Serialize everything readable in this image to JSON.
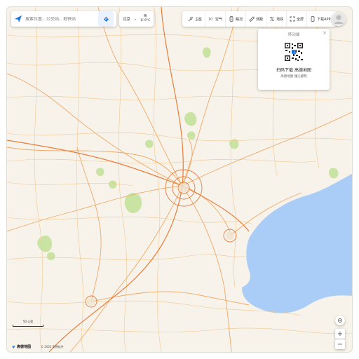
{
  "search": {
    "placeholder": "搜索位置、公交站、地铁站"
  },
  "weather": {
    "city": "北京",
    "condition": "晴",
    "temperature": "1/-9°C"
  },
  "toolbar": {
    "items": [
      {
        "label": "卫星",
        "icon": "satellite-icon"
      },
      {
        "label": "空气",
        "icon": "air-icon"
      },
      {
        "label": "路况",
        "icon": "traffic-icon"
      },
      {
        "label": "测距",
        "icon": "ruler-icon"
      },
      {
        "label": "地铁",
        "icon": "subway-icon"
      },
      {
        "label": "全屏",
        "icon": "fullscreen-icon"
      },
      {
        "label": "下载APP",
        "icon": "phone-icon"
      }
    ]
  },
  "qr_popup": {
    "title": "移动端",
    "close": "×",
    "headline": "扫码下载 高德地图",
    "subline": "高德地图 懂儿都熟"
  },
  "scale": {
    "label": "50 公里"
  },
  "footer": {
    "brand": "高德地图",
    "copyright": "© 2025 高德软件"
  },
  "controls": {
    "zoom_in": "+",
    "zoom_out": "−"
  },
  "colors": {
    "land": "#f7f3ea",
    "sea": "#a9cdf7",
    "road": "#f0a865",
    "highway": "#e87e3c",
    "park": "#c9e3a3",
    "accent": "#1a73e8"
  }
}
